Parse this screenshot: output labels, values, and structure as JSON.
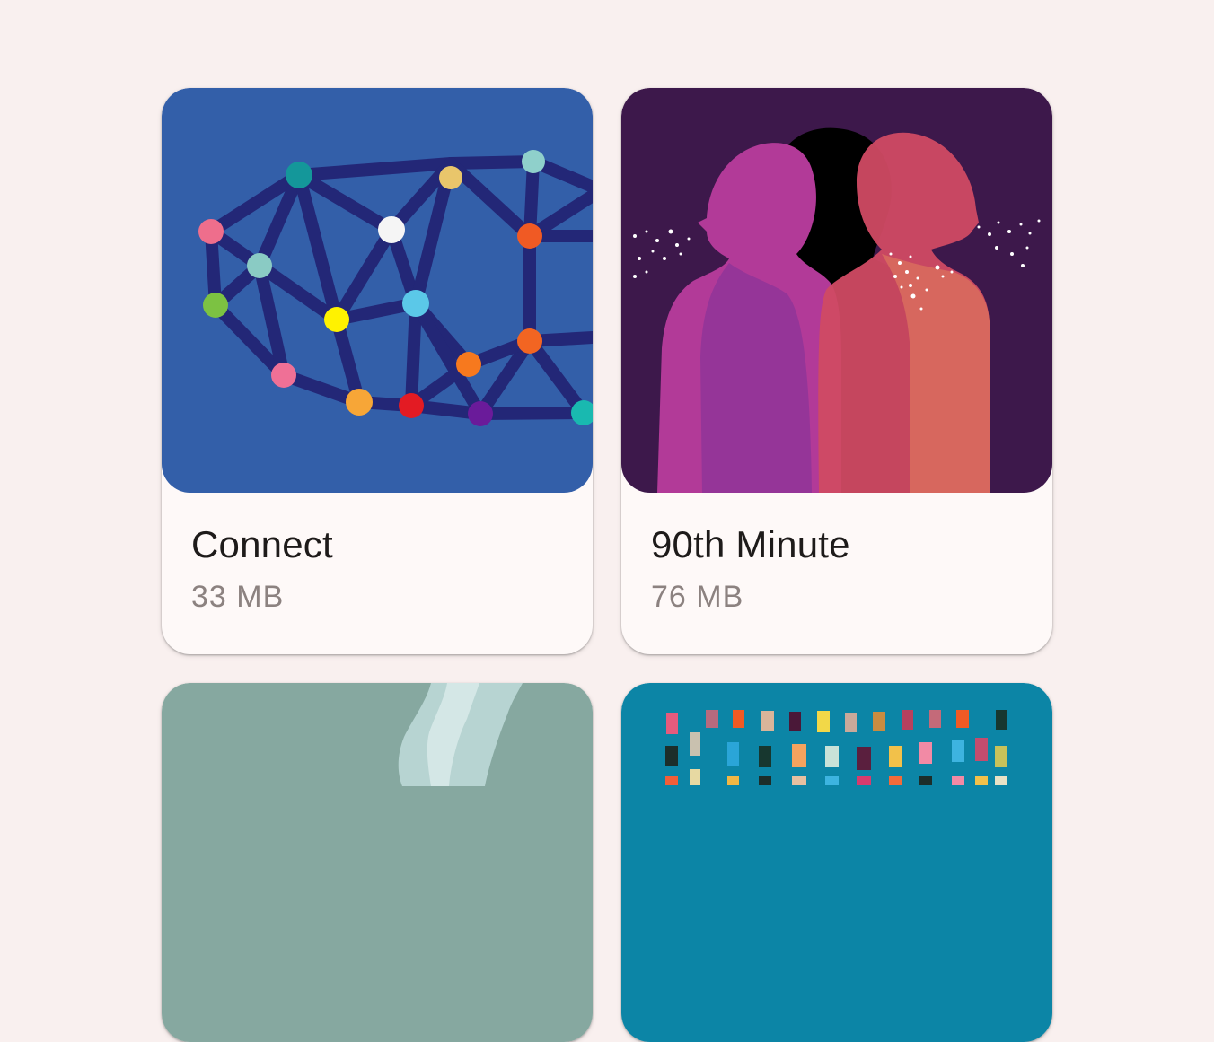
{
  "albums": [
    {
      "title": "Connect",
      "size": "33 MB",
      "art_icon": "network-dots-art",
      "colors": {
        "background": "#335FA9",
        "lines": "#232777"
      }
    },
    {
      "title": "90th Minute",
      "size": "76 MB",
      "art_icon": "silhouettes-art",
      "colors": {
        "background": "#3D184B",
        "primary": "#B23A98",
        "secondary": "#D04A63"
      }
    },
    {
      "art_icon": "hand-art",
      "colors": {
        "background": "#86A8A0"
      }
    },
    {
      "art_icon": "color-swatches-art",
      "colors": {
        "background": "#0C85A6"
      }
    }
  ]
}
